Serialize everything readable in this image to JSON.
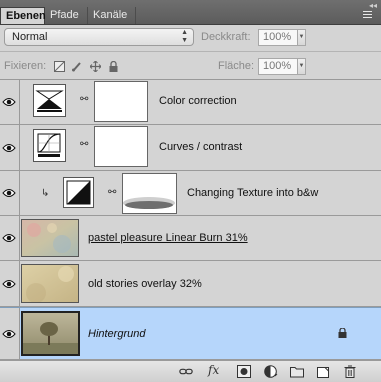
{
  "tabs": [
    "Ebenen",
    "Pfade",
    "Kanäle"
  ],
  "blend_mode": "Normal",
  "opacity": {
    "label": "Deckkraft:",
    "value": "100%"
  },
  "lock": {
    "label": "Fixieren:"
  },
  "fill": {
    "label": "Fläche:",
    "value": "100%"
  },
  "layers": [
    {
      "name": "Color correction",
      "kind": "adjustment-levels",
      "visible": true
    },
    {
      "name": "Curves / contrast",
      "kind": "adjustment-curves",
      "visible": true
    },
    {
      "name": "Changing Texture into b&w",
      "kind": "adjustment-bw",
      "visible": true,
      "clipped": true
    },
    {
      "name": "pastel pleasure Linear Burn 31%",
      "kind": "image",
      "visible": true
    },
    {
      "name": "old stories overlay 32%",
      "kind": "image",
      "visible": true
    },
    {
      "name": "Hintergrund",
      "kind": "background",
      "visible": true,
      "selected": true,
      "locked": true
    }
  ],
  "bottom_icons": [
    "link-icon",
    "fx-icon",
    "add-mask-icon",
    "adjustment-layer-icon",
    "new-group-icon",
    "new-layer-icon",
    "trash-icon"
  ],
  "colors": {
    "selected_row": "#b6d6fb",
    "panel_bg": "#d4d4d4"
  }
}
